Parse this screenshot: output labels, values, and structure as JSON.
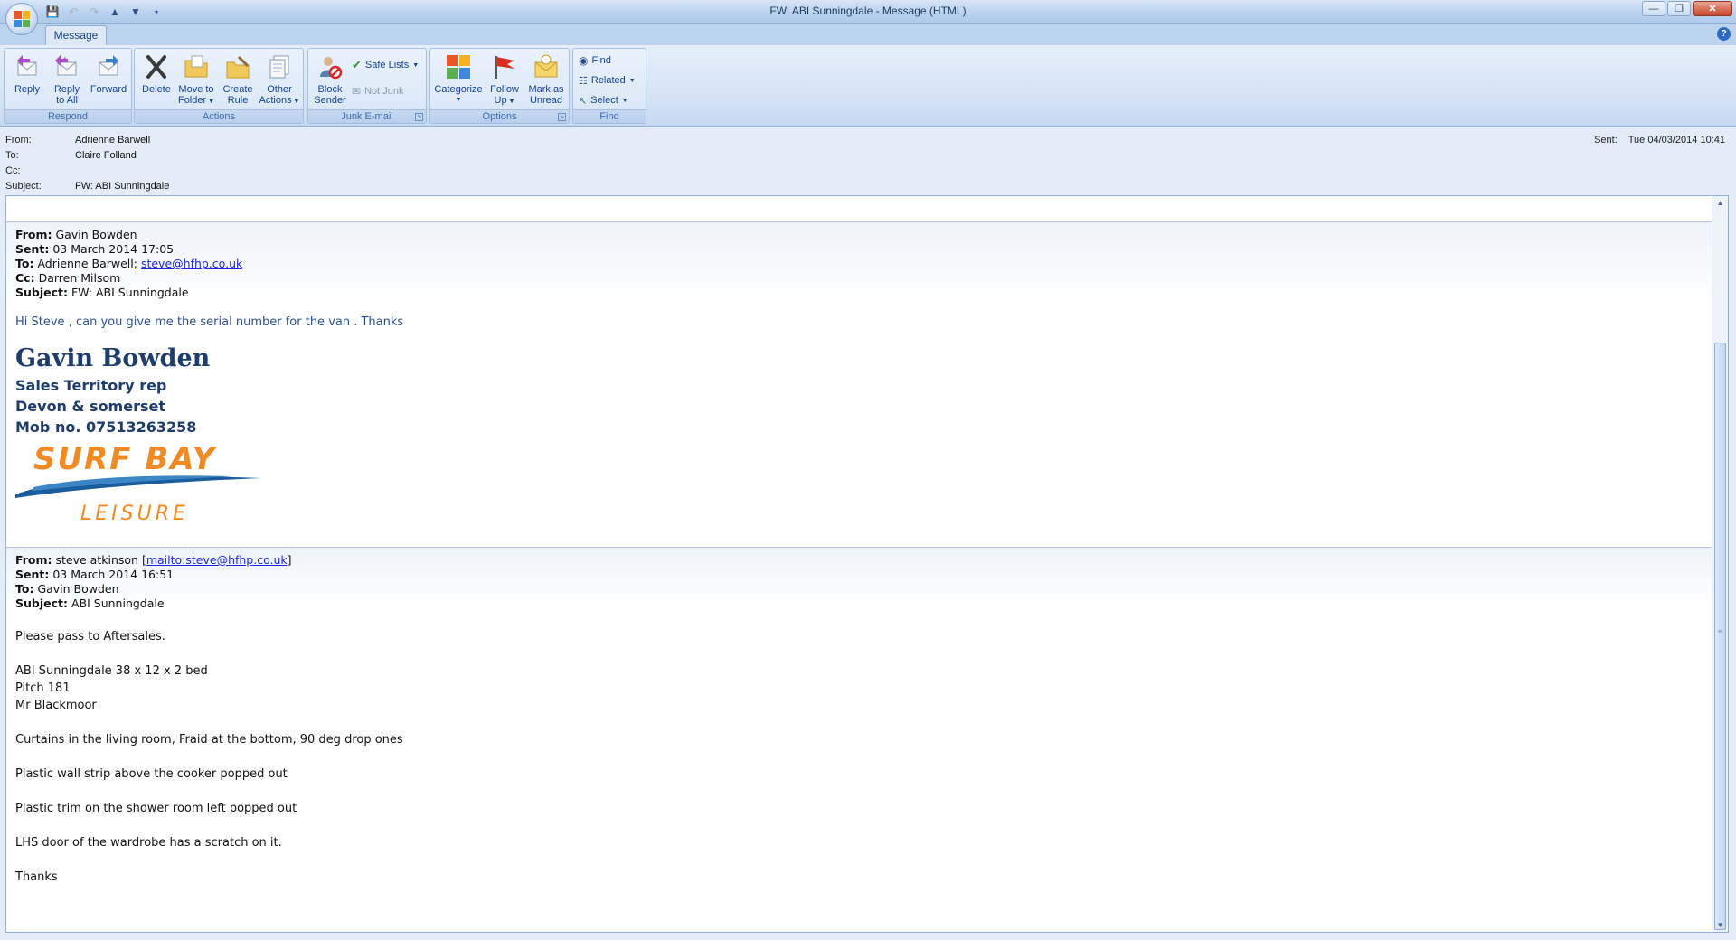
{
  "window": {
    "title": "FW: ABI Sunningdale - Message (HTML)"
  },
  "qat": [
    "save-icon",
    "undo-icon",
    "redo-icon",
    "previous-item-icon",
    "next-item-icon",
    "customize-icon"
  ],
  "ribbon": {
    "tab": "Message",
    "groups": {
      "respond": {
        "label": "Respond",
        "reply": "Reply",
        "reply_all_1": "Reply",
        "reply_all_2": "to All",
        "forward": "Forward"
      },
      "actions": {
        "label": "Actions",
        "delete": "Delete",
        "move_1": "Move to",
        "move_2": "Folder",
        "rule_1": "Create",
        "rule_2": "Rule",
        "other_1": "Other",
        "other_2": "Actions"
      },
      "junk": {
        "label": "Junk E-mail",
        "block_1": "Block",
        "block_2": "Sender",
        "safe_lists": "Safe Lists",
        "not_junk": "Not Junk"
      },
      "options": {
        "label": "Options",
        "categorize": "Categorize",
        "follow_1": "Follow",
        "follow_2": "Up",
        "mark_1": "Mark as",
        "mark_2": "Unread"
      },
      "find": {
        "label": "Find",
        "find": "Find",
        "related": "Related",
        "select": "Select"
      }
    }
  },
  "header": {
    "from_label": "From:",
    "from": "Adrienne Barwell",
    "to_label": "To:",
    "to": "Claire Folland",
    "cc_label": "Cc:",
    "cc": "",
    "subject_label": "Subject:",
    "subject": "FW: ABI Sunningdale",
    "sent_label": "Sent:",
    "sent": "Tue 04/03/2014 10:41"
  },
  "message1": {
    "from_label": "From:",
    "from": "Gavin Bowden",
    "sent_label": "Sent:",
    "sent": "03 March 2014 17:05",
    "to_label": "To:",
    "to": "Adrienne Barwell;",
    "to_link": "steve@hfhp.co.uk",
    "cc_label": "Cc:",
    "cc": "Darren Milsom",
    "subject_label": "Subject:",
    "subject": "FW: ABI Sunningdale",
    "body": "Hi Steve , can you give me the serial number for the van . Thanks",
    "signature": {
      "name": "Gavin Bowden",
      "role": "Sales Territory rep",
      "area": "Devon & somerset",
      "mobile": "Mob no. 07513263258",
      "logo_line1": "SURF BAY",
      "logo_line2": "LEISURE"
    }
  },
  "message2": {
    "from_label": "From:",
    "from": "steve atkinson",
    "from_link": "mailto:steve@hfhp.co.uk",
    "from_open": "[",
    "from_close": "]",
    "sent_label": "Sent:",
    "sent": "03 March 2014 16:51",
    "to_label": "To:",
    "to": "Gavin Bowden",
    "subject_label": "Subject:",
    "subject": "ABI Sunningdale",
    "lines": [
      "Please pass to Aftersales.",
      "ABI Sunningdale 38 x 12 x 2 bed",
      "Pitch 181",
      "Mr Blackmoor",
      "Curtains in the living room, Fraid at the bottom, 90 deg drop ones",
      "Plastic wall strip above the cooker popped out",
      "Plastic trim on the shower room left popped out",
      "LHS door of the wardrobe has a scratch on it.",
      "Thanks"
    ]
  },
  "colors": {
    "accent": "#15428b",
    "link": "#1d2ad8",
    "signature": "#1f3d6b",
    "logo_orange": "#f08a24",
    "logo_blue": "#1a5d9e"
  }
}
